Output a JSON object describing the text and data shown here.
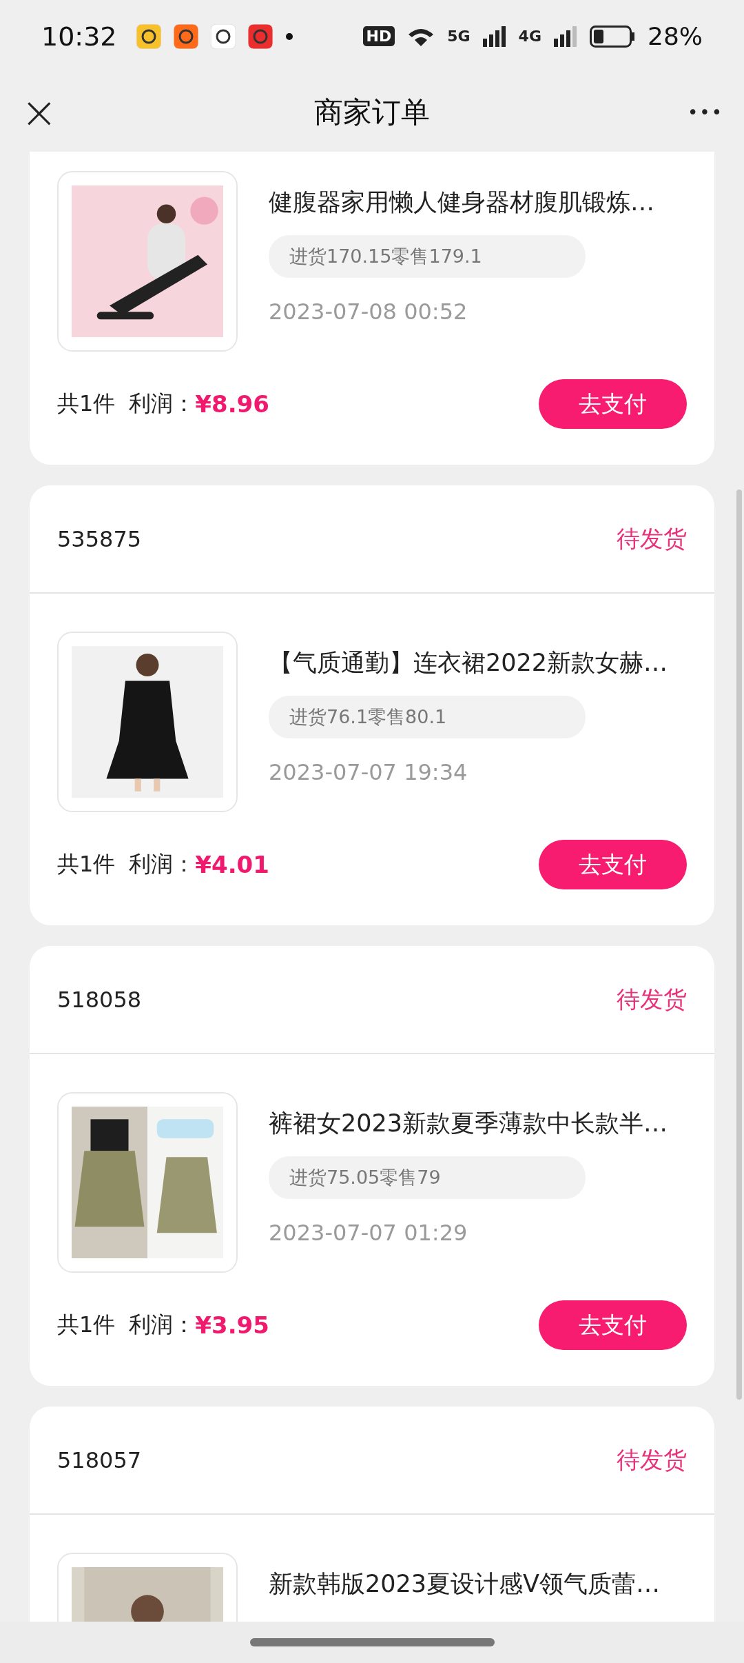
{
  "status_bar": {
    "time": "10:32",
    "badges": [
      "HD",
      "5G",
      "4G"
    ],
    "battery": "28%"
  },
  "header": {
    "close": "×",
    "title": "商家订单",
    "more": "•••"
  },
  "orders": [
    {
      "title": "健腹器家用懒人健身器材腹肌锻炼…",
      "price_tag": "进货170.15零售179.1",
      "date": "2023-07-08 00:52",
      "count": "共1件",
      "profit_label": "利润：",
      "profit": "¥8.96",
      "button": "去支付"
    },
    {
      "id": "535875",
      "status": "待发货",
      "title": "【气质通勤】连衣裙2022新款女赫…",
      "price_tag": "进货76.1零售80.1",
      "date": "2023-07-07 19:34",
      "count": "共1件",
      "profit_label": "利润：",
      "profit": "¥4.01",
      "button": "去支付"
    },
    {
      "id": "518058",
      "status": "待发货",
      "title": "裤裙女2023新款夏季薄款中长款半…",
      "price_tag": "进货75.05零售79",
      "date": "2023-07-07 01:29",
      "count": "共1件",
      "profit_label": "利润：",
      "profit": "¥3.95",
      "button": "去支付"
    },
    {
      "id": "518057",
      "status": "待发货",
      "title": "新款韩版2023夏设计感V领气质蕾…"
    }
  ]
}
